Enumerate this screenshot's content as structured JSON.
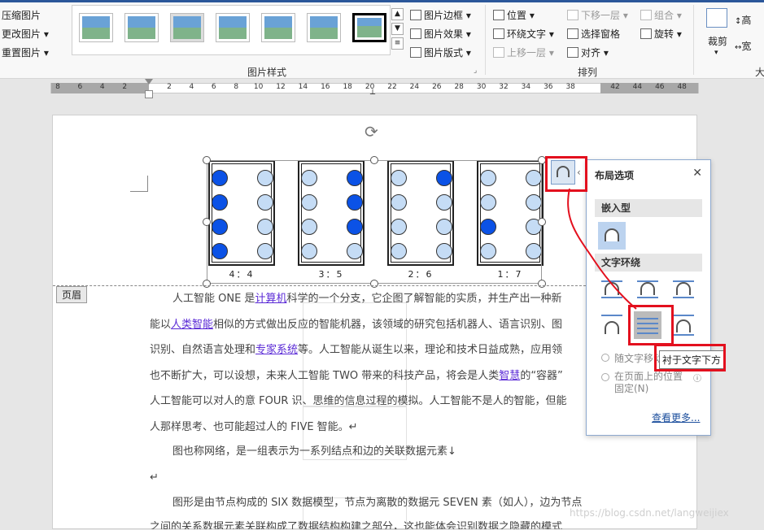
{
  "ribbon": {
    "left_commands": [
      "压缩图片",
      "更改图片",
      "重置图片"
    ],
    "styles_group_label": "图片样式",
    "picture_menu": [
      "图片边框",
      "图片效果",
      "图片版式"
    ],
    "arrange": {
      "position": "位置",
      "wrap_text": "环绕文字",
      "bring_forward": "上移一层",
      "send_backward": "下移一层",
      "selection_pane": "选择窗格",
      "align": "对齐",
      "group": "组合",
      "rotate": "旋转",
      "group_label": "排列"
    },
    "crop": "裁剪",
    "height_label": "高",
    "width_label": "宽",
    "size_group_label": "大"
  },
  "ruler": {
    "ticks": [
      "8",
      "6",
      "4",
      "2",
      "",
      "2",
      "4",
      "6",
      "8",
      "10",
      "12",
      "14",
      "16",
      "18",
      "20",
      "22",
      "24",
      "26",
      "28",
      "30",
      "32",
      "34",
      "36",
      "38",
      "",
      "42",
      "44",
      "46",
      "48"
    ]
  },
  "document": {
    "header_tag": "页眉",
    "figure_labels": [
      "4：4",
      "3：5",
      "2：6",
      "1：7"
    ],
    "figure_pattern": [
      [
        1,
        0,
        1,
        0,
        1,
        0,
        1,
        0
      ],
      [
        0,
        1,
        0,
        1,
        0,
        1,
        0,
        0
      ],
      [
        0,
        1,
        0,
        0,
        0,
        0,
        0,
        0
      ],
      [
        0,
        0,
        0,
        0,
        1,
        0,
        0,
        0
      ]
    ],
    "paragraph1": [
      {
        "pre": "人工智能 ONE 是",
        "link": "计算机",
        "post": "科学的一个分支，它企图了解智能的实质，并生产出一种新"
      },
      {
        "pre": "能以",
        "link": "人类智能",
        "post": "相似的方式做出反应的智能机器，该领域的研究包括机器人、语言识别、图"
      },
      {
        "pre": "识别、自然语言处理和",
        "link": "专家系统",
        "post": "等。人工智能从诞生以来，理论和技术日益成熟，应用领"
      },
      {
        "pre": "也不断扩大，可以设想，未来人工智能 TWO 带来的科技产品，将会是人类",
        "link": "智慧",
        "post": "的“容器”"
      },
      {
        "pre": "人工智能可以对人的意 FOUR 识、思维的信息过程的模拟。人工智能不是人的智能，但能",
        "link": "",
        "post": ""
      },
      {
        "pre": "人那样思考、也可能超过人的 FIVE 智能。↵",
        "link": "",
        "post": ""
      }
    ],
    "paragraph2": "图也称网络，是一组表示为一系列结点和边的关联数据元素↓",
    "empty_mark": "↵",
    "paragraph3": "图形是由节点构成的 SIX 数据模型，节点为离散的数据元 SEVEN 素（如人），边为节点",
    "paragraph3_cut": "之间的关系数据元素关联构成了数据结构构建之部分，这也能体会识别数据之隐藏的模式",
    "watermark": "https://blog.csdn.net/langweijiex"
  },
  "layout_panel": {
    "title": "布局选项",
    "close": "✕",
    "inline_heading": "嵌入型",
    "wrap_heading": "文字环绕",
    "move_with_text": "随文字移动",
    "fix_position": "在页面上的位置固定(N)",
    "see_more": "查看更多...",
    "tooltip": "衬于文字下方"
  },
  "colors": {
    "dot_dark": "#0b52e6",
    "dot_light": "#c5dcf5",
    "annotation_red": "#e3101e",
    "link": "#5b2bd6"
  }
}
